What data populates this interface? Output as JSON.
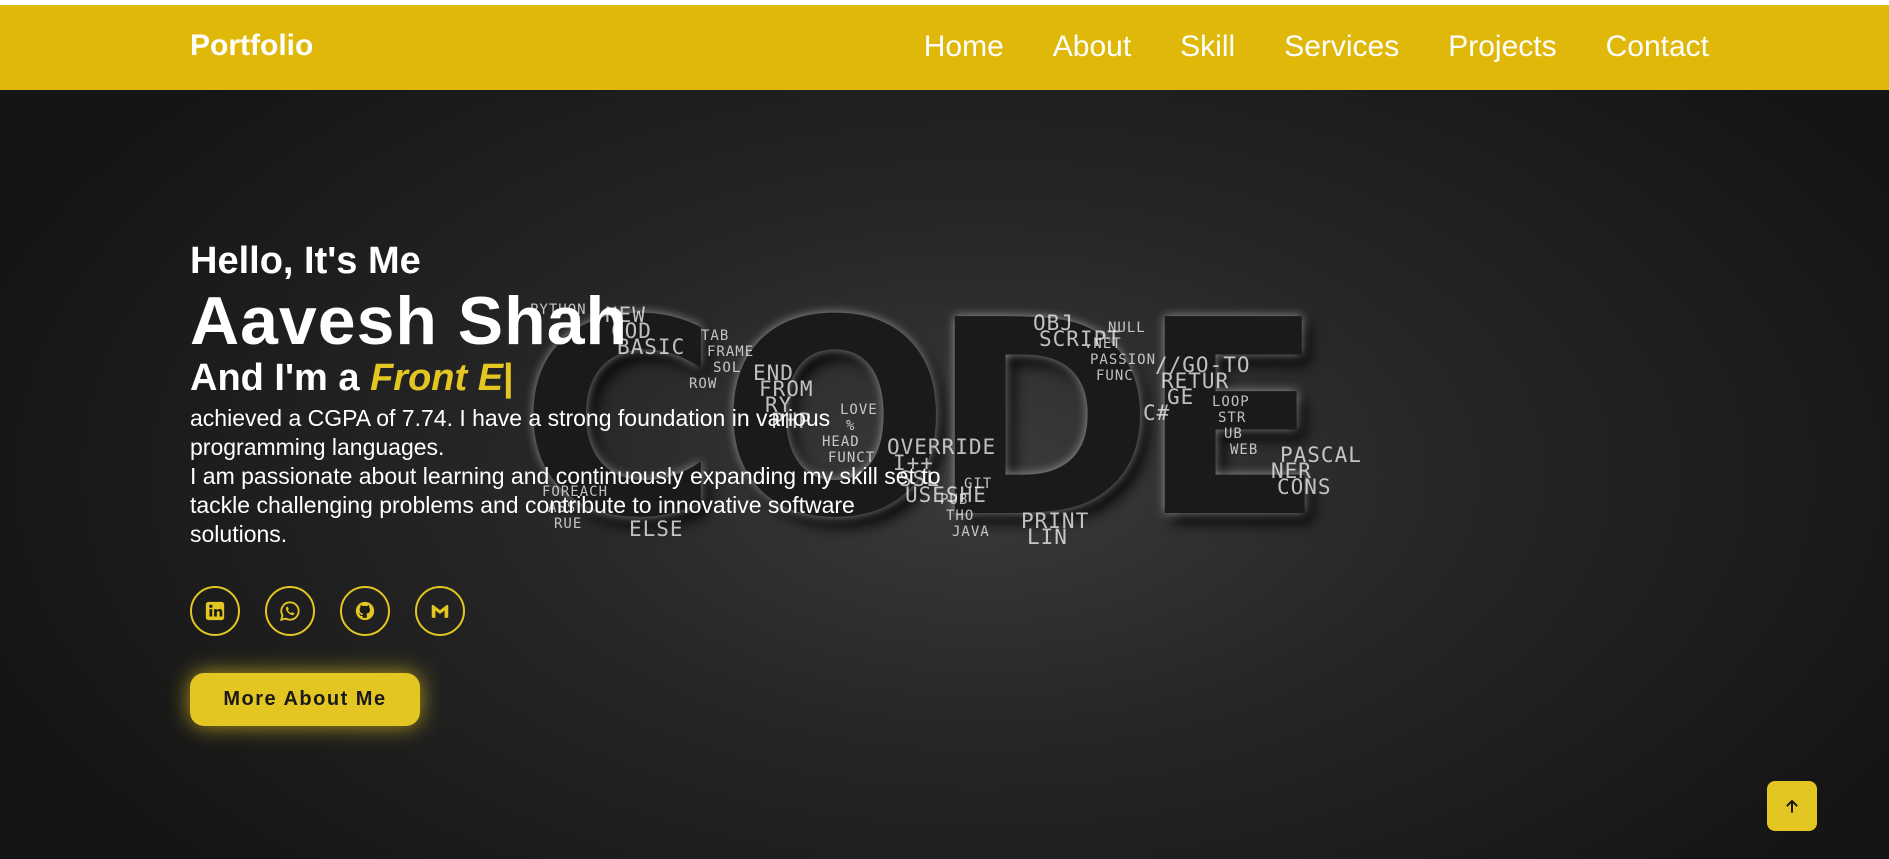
{
  "nav": {
    "logo": "Portfolio",
    "links": [
      "Home",
      "About",
      "Skill",
      "Services",
      "Projects",
      "Contact"
    ]
  },
  "hero": {
    "greeting": "Hello, It's Me",
    "name": "Aavesh Shah",
    "role_prefix": "And I'm a ",
    "role_typed": "Front E",
    "role_cursor": "|",
    "bio_line1": "achieved a CGPA of 7.74. I have a strong foundation in various programming languages.",
    "bio_line2": "I am passionate about learning and continuously expanding my skill set to tackle challenging problems and contribute to innovative software solutions.",
    "more_button": "More About Me"
  },
  "socials": [
    {
      "icon": "linkedin-icon"
    },
    {
      "icon": "whatsapp-icon"
    },
    {
      "icon": "github-icon"
    },
    {
      "icon": "gmail-icon"
    }
  ],
  "code_art": {
    "letters": [
      "C",
      "O",
      "D",
      "E"
    ],
    "words": [
      "PYTHON",
      "BASIC",
      "ROW",
      "PHP",
      "FUNCT",
      "USESHE",
      "JAVA",
      "SCRIPT",
      "FUNC",
      "C#",
      "WEB",
      "CONS",
      "RUE",
      "COD",
      "SOL",
      "RY",
      "HEAD",
      "SSL",
      "THO",
      "OBJ",
      "PASSION",
      "GE",
      "UB",
      "NER",
      "ASS",
      "NEW",
      "FRAME",
      "FROM",
      "%",
      "I++",
      "PUB",
      "LIN",
      ".NET",
      "RETUR",
      "STR",
      "PASCAL",
      "FOREACH",
      "ELSE",
      "TAB",
      "END",
      "LOVE",
      "OVERRIDE",
      "GIT",
      "PRINT",
      "NULL",
      "//GO-TO",
      "LOOP"
    ]
  },
  "colors": {
    "accent": "#e3c622",
    "nav_bg": "#dfb809",
    "hero_bg": "#1f1f1f"
  }
}
